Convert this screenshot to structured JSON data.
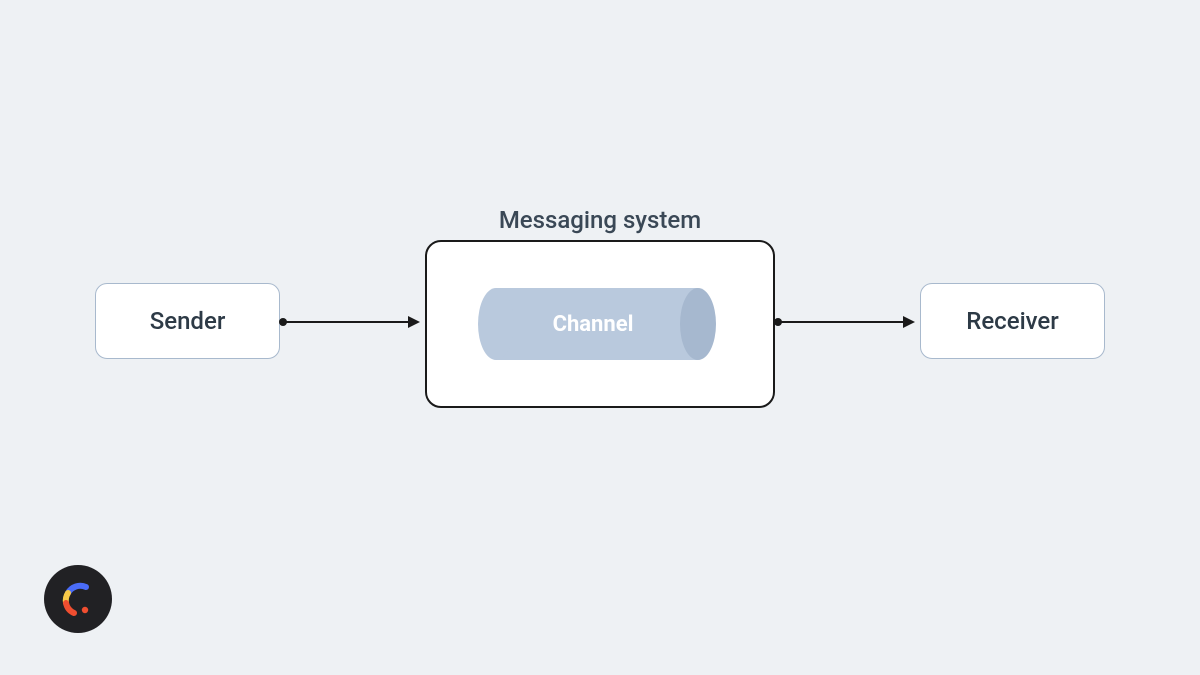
{
  "diagram": {
    "title": "Messaging system",
    "nodes": {
      "sender": {
        "label": "Sender"
      },
      "receiver": {
        "label": "Receiver"
      },
      "channel": {
        "label": "Channel"
      }
    },
    "messaging_box_label": "Messaging system",
    "colors": {
      "background": "#eef1f4",
      "node_border": "#a8b9cd",
      "messaging_border": "#1a1a1a",
      "channel_fill": "#b9c9dd",
      "channel_shadow": "#a6b8cf",
      "text_dark": "#2d3a46",
      "arrow": "#1a1a1a"
    }
  }
}
